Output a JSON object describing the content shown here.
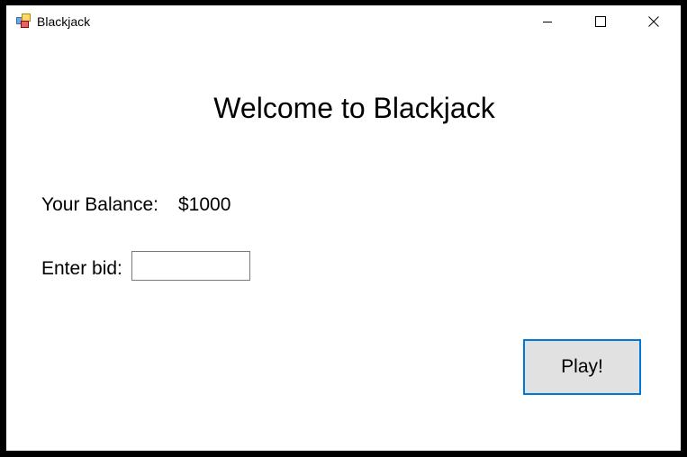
{
  "window": {
    "title": "Blackjack",
    "icon": "windows-forms-app-icon",
    "controls": [
      "minimize-icon",
      "maximize-icon",
      "close-icon"
    ]
  },
  "main": {
    "heading": "Welcome to Blackjack",
    "balance_label": "Your Balance:",
    "balance_value": "$1000",
    "bid_label": "Enter bid:",
    "bid_value": "",
    "play_label": "Play!"
  },
  "colors": {
    "frame": "#000000",
    "background": "#ffffff",
    "button_face": "#e1e1e1",
    "focus_accent": "#0078d7",
    "input_border": "#7a7a7a"
  }
}
